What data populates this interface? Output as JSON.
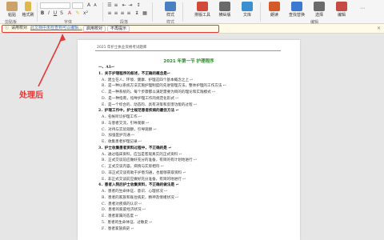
{
  "ribbon": {
    "paste_label": "粘贴",
    "format_painter_label": "格式刷",
    "groups": [
      "剪贴板",
      "字体",
      "段落",
      "样式",
      "编辑"
    ],
    "buttons": [
      {
        "label": "样式",
        "color": "#4a7fc1"
      },
      {
        "label": "排版工具",
        "color": "#d04a3a"
      },
      {
        "label": "横纵版",
        "color": "#6a6a6a"
      },
      {
        "label": "文库",
        "color": "#3a8fd0"
      },
      {
        "label": "朗读",
        "color": "#d45a2a"
      },
      {
        "label": "查找替换",
        "color": "#3a7ad0"
      },
      {
        "label": "选择",
        "color": "#6a6a6a"
      },
      {
        "label": "编辑",
        "color": "#c74a44"
      }
    ],
    "more_labels": [
      "排版工具",
      "横纵版"
    ]
  },
  "notice": {
    "title": "请用校对",
    "message": "此文档中未检查到可以编辑...",
    "button1": "启用校对",
    "button2": "不再提示",
    "close_icon": "close-icon"
  },
  "callout": {
    "label": "处理后",
    "color": "#e23a3a"
  },
  "document": {
    "header": "2021 年护士执业资格考试题库",
    "title": "2021 年第一节 护理程序",
    "lines": [
      {
        "text": "一、A1↩",
        "style": "bold"
      },
      {
        "text": "1．关于护理程序的叙述，不正确的概念是↩",
        "style": "bold"
      },
      {
        "text": "A．建立在人、环境、健康、护理这四个基本概念之上 ↩",
        "style": "ind"
      },
      {
        "text": "B．是一种以系统方法实施护理制度的先进管理方法，整体护理的工作方法 ↩",
        "style": "ind"
      },
      {
        "text": "C．是一种系统的，每个步骤都以满足需要为目的的理论和实践模式 ↩",
        "style": "ind"
      },
      {
        "text": "D．是一种指南，指导护理工作的规范化形式 ↩",
        "style": "ind"
      },
      {
        "text": "E．是一个综合的、动态的、具有决策和反馈功能的过程 ↩",
        "style": "ind"
      },
      {
        "text": "2．护理工作中，护士规范患者疾病的最佳方法 ↩",
        "style": "bold"
      },
      {
        "text": "A．名帐听诊护理工作 ↩",
        "style": "ind"
      },
      {
        "text": "B．与患者交流，引导观察 ↩",
        "style": "ind"
      },
      {
        "text": "C．对待与实验观察，引导观察 ↩",
        "style": "ind"
      },
      {
        "text": "D．加强医护沟通 ↩",
        "style": "ind"
      },
      {
        "text": "E．收集患者护理记录 ↩",
        "style": "ind"
      },
      {
        "text": "3．护士收集患者资料过程中，不正确的是 ↩",
        "style": "bold"
      },
      {
        "text": "A．通过临床资料，应当是客观真实的正式资料 ↩",
        "style": "ind"
      },
      {
        "text": "B．正式交谈前应做好充分的准备，有目的有计划地进行 ↩",
        "style": "ind"
      },
      {
        "text": "C．正式交谈内容，病情与实际相符 ↩",
        "style": "ind"
      },
      {
        "text": "D．非正式交谈有助于护患沟通，也能够获取资料 ↩",
        "style": "ind"
      },
      {
        "text": "E．非正式交谈前应做好充分准备，有目的地进行 ↩",
        "style": "ind"
      },
      {
        "text": "4．患者入院后护士收集资料，不正确的做法是 ↩",
        "style": "bold"
      },
      {
        "text": "A．患者的生命体征、意识、心理状况 ↩",
        "style": "ind"
      },
      {
        "text": "B．患者的家族和既往病史，精神及情绪状况 ↩",
        "style": "ind"
      },
      {
        "text": "C．患者对疾病的认识 ↩",
        "style": "ind"
      },
      {
        "text": "D．患者的家庭经济状况 ↩",
        "style": "ind"
      },
      {
        "text": "E．患者家属的态度 ↩",
        "style": "ind"
      },
      {
        "text": "5．患者的生命体征、过敏史 ↩",
        "style": "ind"
      },
      {
        "text": "F．患者家族病史 ↩",
        "style": "ind"
      }
    ]
  }
}
